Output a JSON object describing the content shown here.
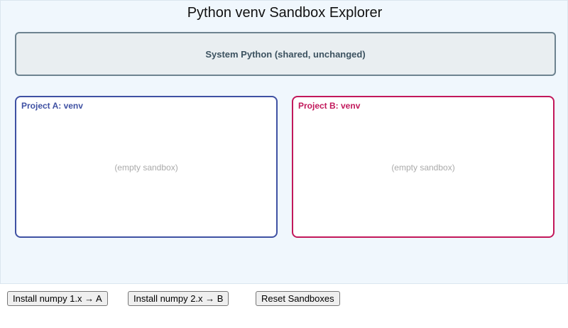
{
  "title": "Python venv Sandbox Explorer",
  "system": {
    "label": "System Python (shared, unchanged)"
  },
  "venvs": [
    {
      "name": "Project A: venv",
      "empty_text": "(empty sandbox)",
      "color": "#3f51a3"
    },
    {
      "name": "Project B: venv",
      "empty_text": "(empty sandbox)",
      "color": "#c2185b"
    }
  ],
  "buttons": {
    "install_a": "Install numpy 1.x → A",
    "install_b": "Install numpy 2.x → B",
    "reset": "Reset Sandboxes"
  }
}
